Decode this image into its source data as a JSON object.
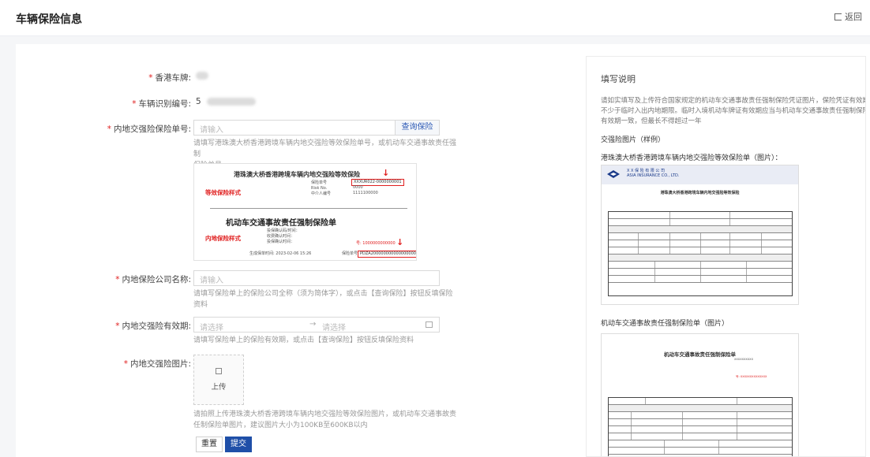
{
  "header": {
    "title": "车辆保险信息",
    "back_label": "返回"
  },
  "form": {
    "hk_plate": {
      "label": "香港车牌:",
      "value": ""
    },
    "vin": {
      "label": "车辆识别编号:",
      "value": "5"
    },
    "policy_no": {
      "label": "内地交强险保险单号:",
      "placeholder": "请输入",
      "query_label": "查询保险",
      "hint_1": "请填写港珠澳大桥香港跨境车辆内地交强险等效保险单号，或机动车交通事故责任强制",
      "hint_2": "保险单号"
    },
    "sample": {
      "title1": "港珠澳大桥香港跨境车辆内地交强险等效保险",
      "equiv_label": "等效保险样式",
      "policy_fields": [
        "保险单号",
        "Risk No.",
        "中介人编号"
      ],
      "policy_values": [
        "XXXUR022-0000000001",
        "0000",
        "1111100000"
      ],
      "title2": "机动车交通事故责任强制保险单",
      "mainland_label": "内地保险样式",
      "mainland_fields": [
        "投保确认码/时间：",
        "收费确认时间：",
        "投保确认时间："
      ],
      "mainland_number": "号: 1000000000000",
      "footer_time": "生成保单时间: 2023-02-06 15:26",
      "footer_policy_label": "保险单号:",
      "footer_policy_value": "PDZA200000000000000000"
    },
    "insurer": {
      "label": "内地保险公司名称:",
      "placeholder": "请输入",
      "hint_1": "请填写保险单上的保险公司全称（须为简体字），或点击【查询保险】按钮反填保险",
      "hint_2": "资料"
    },
    "validity": {
      "label": "内地交强险有效期:",
      "start_placeholder": "请选择",
      "separator": "→",
      "end_placeholder": "请选择",
      "hint": "请填写保险单上的保险有效期，或点击【查询保险】按钮反填保险资料"
    },
    "image": {
      "label": "内地交强险图片:",
      "upload_label": "上传",
      "hint_1": "请拍照上传港珠澳大桥香港跨境车辆内地交强险等效保险图片，或机动车交通事故责",
      "hint_2": "任制保险单图片，建议图片大小为100KB至600KB以内"
    },
    "reset_label": "重置",
    "submit_label": "提交"
  },
  "panel": {
    "title": "填写说明",
    "desc": "请如实填写及上传符合国家规定的机动车交通事故责任强制保险凭证图片，保险凭证有效期不少于临时入出内地期限。临时入境机动车牌证有效期应当与机动车交通事故责任强制保险有效期一致，但最长不得超过一年",
    "sample_label": "交强险图片（样例）",
    "doc1_caption": "港珠澳大桥香港跨境车辆内地交强险等效保险单（图片）：",
    "doc1": {
      "company_cn": "X X 保 险 有 限 公 司",
      "company_en": "ASIA INSURANCE CO., LTD.",
      "title": "港珠澳大桥香港跨境车辆内地交强险等效保险"
    },
    "doc2_caption": "机动车交通事故责任强制保险单（图片）",
    "doc2": {
      "title": "机动车交通事故责任强制保险单",
      "number": "XXXXXXXXXX",
      "policy_num": "号: XXXXXXXXXXXXXX"
    },
    "accent_color": "#1f4fa8"
  }
}
